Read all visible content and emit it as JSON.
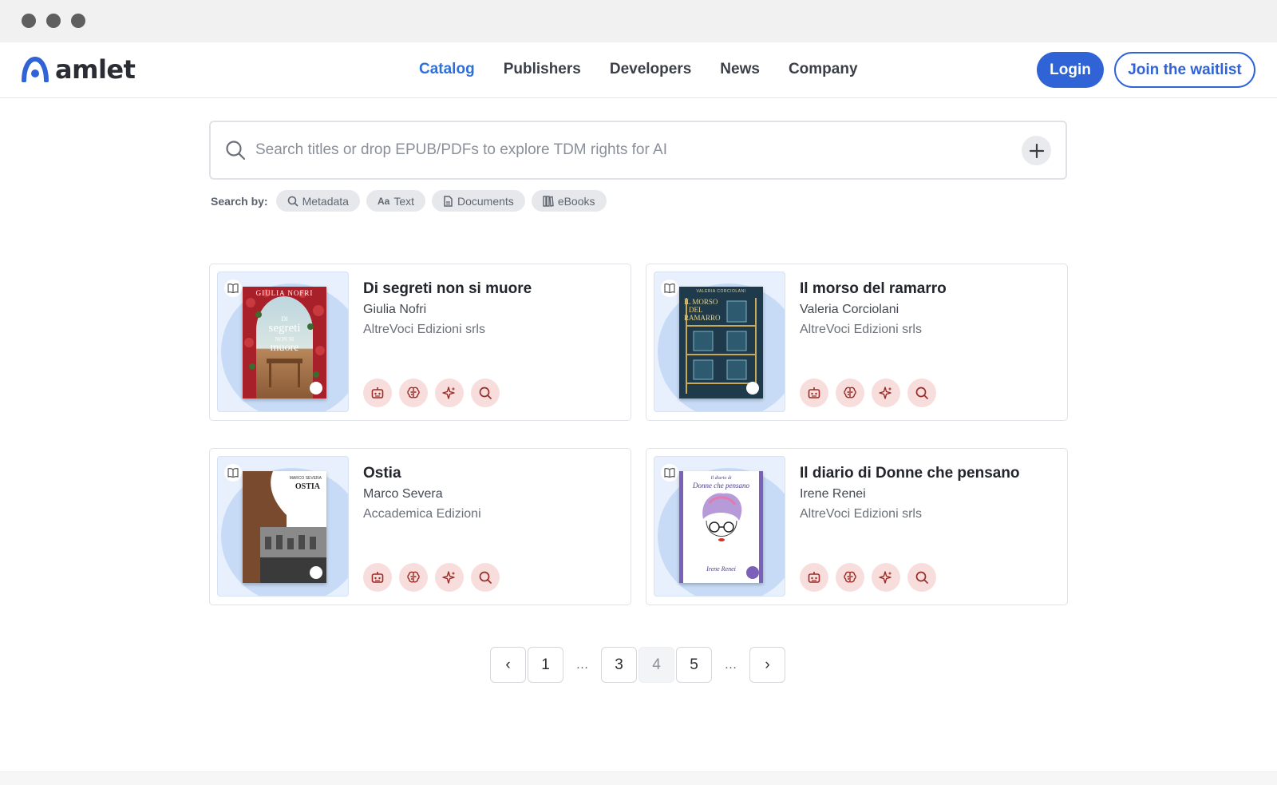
{
  "brand": {
    "name": "amlet",
    "accent": "#2f63d6"
  },
  "nav": [
    {
      "label": "Catalog",
      "active": true
    },
    {
      "label": "Publishers",
      "active": false
    },
    {
      "label": "Developers",
      "active": false
    },
    {
      "label": "News",
      "active": false
    },
    {
      "label": "Company",
      "active": false
    }
  ],
  "header": {
    "login_label": "Login",
    "waitlist_label": "Join the waitlist"
  },
  "search": {
    "placeholder": "Search titles or drop EPUB/PDFs to explore TDM rights for AI",
    "value": "",
    "by_label": "Search by:",
    "chips": [
      {
        "label": "Metadata",
        "icon": "search-icon"
      },
      {
        "label": "Text",
        "icon": "text-icon"
      },
      {
        "label": "Documents",
        "icon": "document-icon"
      },
      {
        "label": "eBooks",
        "icon": "ebooks-icon"
      }
    ]
  },
  "books": [
    {
      "title": "Di segreti non si muore",
      "author": "Giulia Nofri",
      "publisher": "AltreVoci Edizioni srls",
      "cover_text": [
        "GIULIA NOFRI",
        "DI",
        "segreti",
        "NON SI",
        "muore"
      ]
    },
    {
      "title": "Il morso del ramarro",
      "author": "Valeria Corciolani",
      "publisher": "AltreVoci Edizioni srls",
      "cover_text": [
        "VALERIA CORCIOLANI",
        "IL MORSO",
        "DEL",
        "RAMARRO"
      ]
    },
    {
      "title": "Ostia",
      "author": "Marco Severa",
      "publisher": "Accademica Edizioni",
      "cover_text": [
        "MARCO SEVERA",
        "OSTIA"
      ]
    },
    {
      "title": "Il diario di Donne che pensano",
      "author": "Irene Renei",
      "publisher": "AltreVoci Edizioni srls",
      "cover_text": [
        "Il diario di",
        "Donne che pensano",
        "Irene Renei"
      ]
    }
  ],
  "actions": [
    "robot-icon",
    "brain-icon",
    "sparkle-icon",
    "magnify-icon"
  ],
  "pagination": {
    "prev": "‹",
    "next": "›",
    "pages": [
      "1",
      "…",
      "3",
      "4",
      "5",
      "…"
    ],
    "current": "4"
  }
}
